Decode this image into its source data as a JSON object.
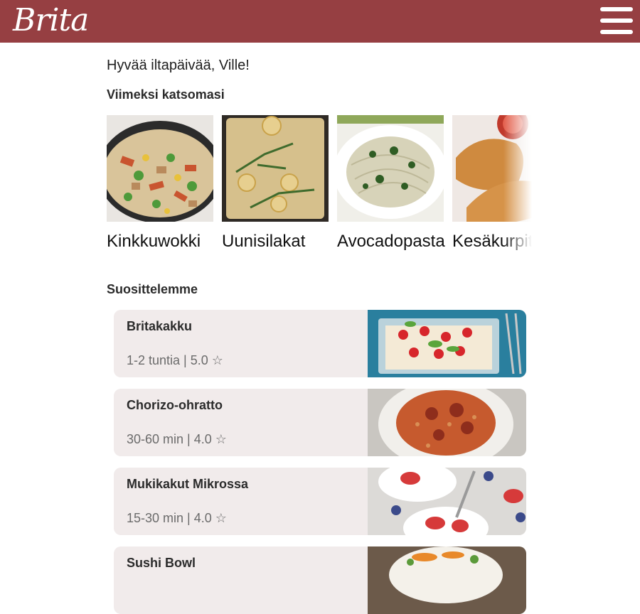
{
  "app": {
    "logo_text": "Brita"
  },
  "greeting": "Hyvää iltapäivää, Ville!",
  "recent": {
    "title": "Viimeksi katsomasi",
    "items": [
      {
        "label": "Kinkkuwokki"
      },
      {
        "label": "Uunisilakat"
      },
      {
        "label": "Avocadopasta"
      },
      {
        "label": "Kesäkurpitsa"
      }
    ]
  },
  "recommended": {
    "title": "Suosittelemme",
    "items": [
      {
        "name": "Britakakku",
        "meta": "1-2 tuntia | 5.0 ☆"
      },
      {
        "name": "Chorizo-ohratto",
        "meta": "30-60 min | 4.0 ☆"
      },
      {
        "name": "Mukikakut Mikrossa",
        "meta": "15-30 min | 4.0 ☆"
      },
      {
        "name": "Sushi Bowl",
        "meta": ""
      }
    ]
  },
  "colors": {
    "header": "#963f42",
    "card_bg": "#f1ebeb"
  }
}
